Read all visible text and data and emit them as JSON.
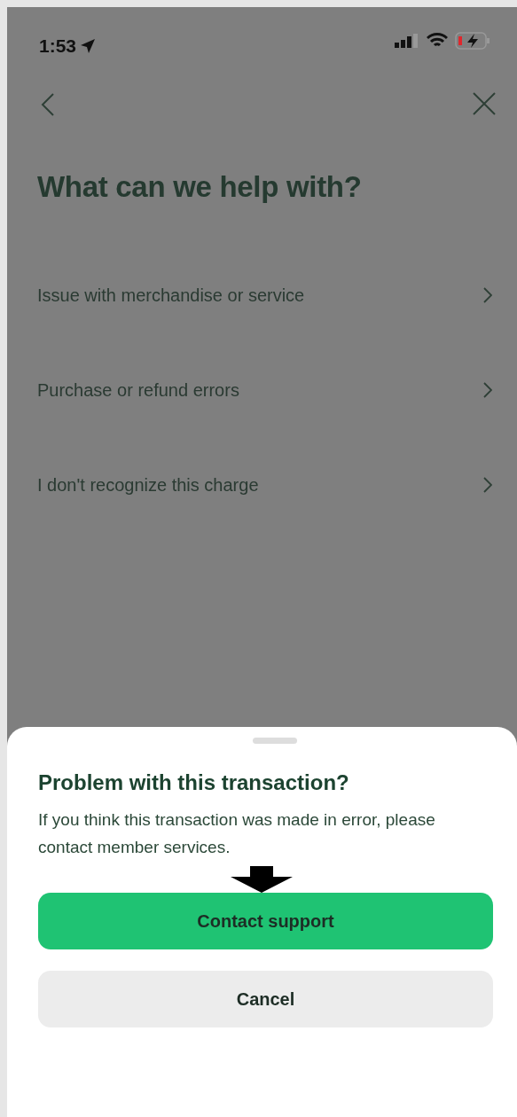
{
  "status_bar": {
    "time": "1:53"
  },
  "title": "What can we help with?",
  "options": [
    {
      "label": "Issue with merchandise or service"
    },
    {
      "label": "Purchase or refund errors"
    },
    {
      "label": "I don't recognize this charge"
    }
  ],
  "sheet": {
    "title": "Problem with this transaction?",
    "message": "If you think this transaction was made in error, please contact member services.",
    "buttons": [
      {
        "label": "Contact support",
        "kind": "primary"
      },
      {
        "label": "Cancel",
        "kind": "secondary"
      }
    ]
  }
}
